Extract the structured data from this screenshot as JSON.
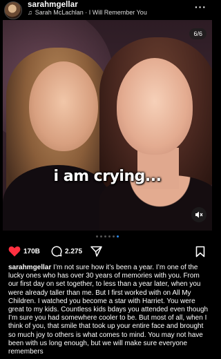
{
  "header": {
    "username": "sarahmgellar",
    "song": "Sarah McLachlan · I Will Remember You",
    "more_icon": "ellipsis-icon"
  },
  "media": {
    "counter": "6/6",
    "overlay_text": "i am crying...",
    "mute_icon": "speaker-muted-icon",
    "carousel_dots": 6,
    "active_dot": 5
  },
  "actions": {
    "like_count": "170B",
    "comment_count": "2.275",
    "like_icon": "heart-icon",
    "comment_icon": "comment-icon",
    "share_icon": "send-icon",
    "save_icon": "bookmark-icon",
    "like_color": "#ff3040"
  },
  "caption": {
    "username": "sarahmgellar",
    "text": "I’m not sure how it’s been a year. I’m one of the lucky ones who has over 30 years of memories with you. From our first day on set together, to less than a year later, when you were already taller than me. But I first worked with on All My Children. I watched you become a star with Harriet. You were great to my kids. Countless kids bdays you attended even though I’m sure you had somewhere cooler to be. But most of all, when I think of you, that smile that took up your entire face and brought so much joy to others is what comes to mind. You may not have been with us long enough, but we will make sure everyone remembers"
  }
}
